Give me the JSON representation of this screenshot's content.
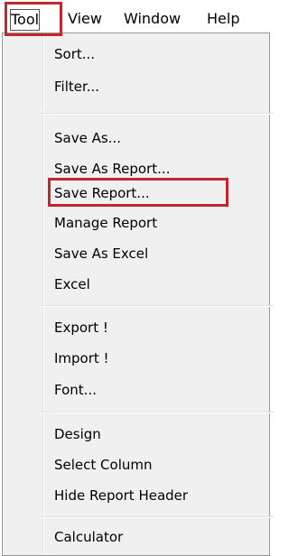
{
  "menubar": {
    "items": [
      {
        "label": "Tool",
        "active": true
      },
      {
        "label": "View"
      },
      {
        "label": "Window"
      },
      {
        "label": "Help"
      }
    ]
  },
  "menu": {
    "groups": [
      [
        "Sort...",
        "Filter..."
      ],
      [
        "Save As...",
        "Save As Report...",
        "Save Report...",
        "Manage Report",
        "Save As Excel",
        "Excel"
      ],
      [
        "Export !",
        "Import !",
        "Font..."
      ],
      [
        "Design",
        "Select Column",
        "Hide Report Header"
      ],
      [
        "Calculator"
      ]
    ],
    "highlighted_item": "Save Report..."
  },
  "colors": {
    "highlight_border": "#c0282e",
    "menu_background": "#f0f0f0"
  }
}
